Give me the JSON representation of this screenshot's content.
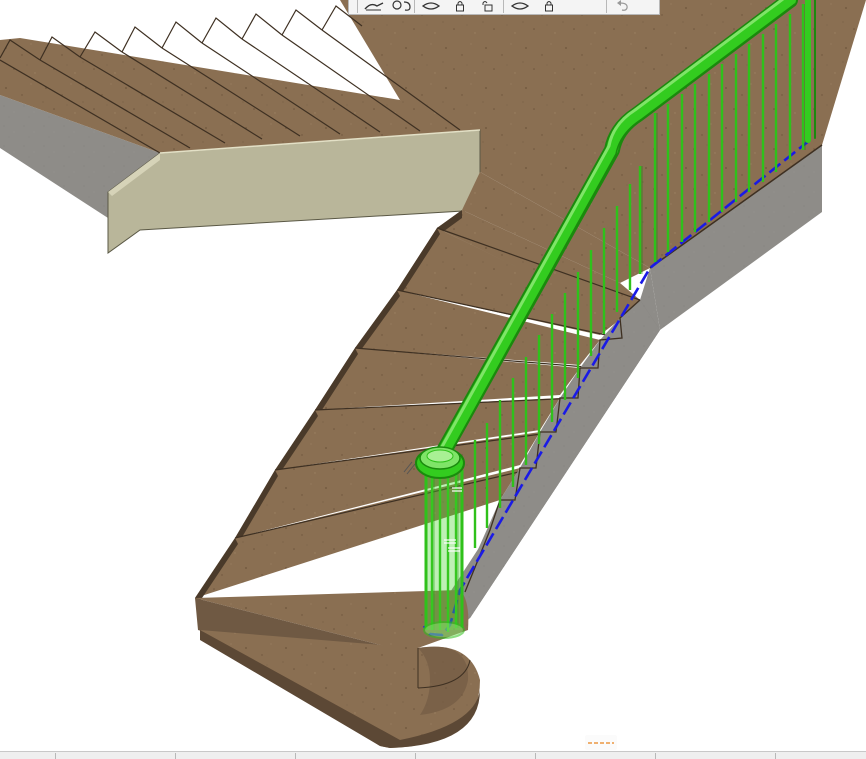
{
  "viewport": {
    "description_colors": {
      "wood": "#8a6f52",
      "riser": "#4a3a2a",
      "concrete": "#8e8c88",
      "railing_selected": "#33cc1f",
      "railing_edge": "#1a8a0d",
      "path_line": "#1a1ae6",
      "panel": "#b9b69a"
    }
  },
  "toolbar": {
    "icons": [
      "railing-tool-icon",
      "mirror-tool-icon",
      "segment-icon",
      "lock-icon",
      "unlock-icon",
      "segment-icon",
      "lock-icon",
      "undo-icon"
    ]
  },
  "status_bar": {
    "icons": [
      "view-icon",
      "direction-icon",
      "arrow-icon",
      "snap-icon",
      "grid-icon",
      "info-icon",
      "layer-icon"
    ],
    "indicator_color": "#e8821e"
  }
}
